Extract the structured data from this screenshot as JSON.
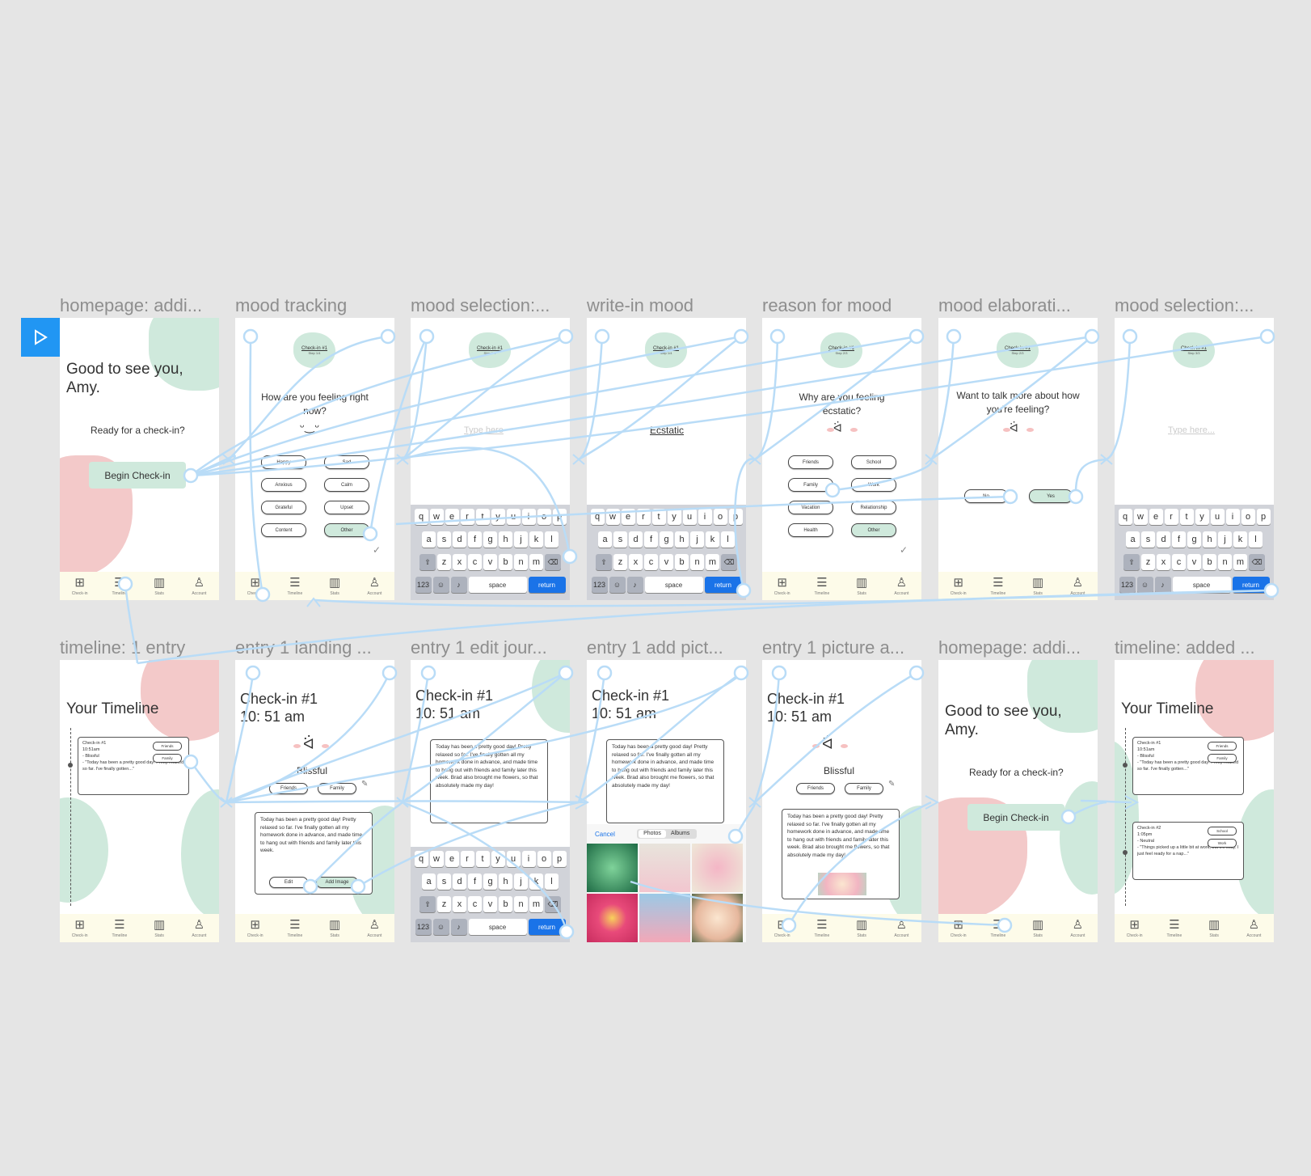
{
  "colors": {
    "canvas": "#e5e5e5",
    "accent": "#2196f3",
    "mint": "#cfe9dc",
    "pink": "#f3c9c9",
    "wire": "#b9dcf7",
    "tabbar": "#fdfbe9",
    "ios_blue": "#1a73e8"
  },
  "frame_titles": [
    "homepage: addi...",
    "mood tracking",
    "mood selection:...",
    "write-in mood",
    "reason for mood",
    "mood elaborati...",
    "mood selection:...",
    "timeline: 1 entry",
    "entry 1 landing ...",
    "entry 1 edit jour...",
    "entry 1 add pict...",
    "entry 1 picture a...",
    "homepage: addi...",
    "timeline: added ..."
  ],
  "tabbar": {
    "checkin": "Check-in",
    "timeline": "Timeline",
    "stats": "Stats",
    "account": "Account"
  },
  "home": {
    "greeting": "Good to see you, Amy.",
    "prompt": "Ready for a check-in?",
    "button": "Begin Check-in"
  },
  "badge": {
    "checkin1": "Check-in #1",
    "step14": "Step 1/4",
    "step23": "Step 2/3",
    "step33": "Step 3/3"
  },
  "mood": {
    "question": "How are you feeling right now?",
    "options": [
      "Happy",
      "Sad",
      "Anxious",
      "Calm",
      "Grateful",
      "Upset",
      "Content",
      "Other"
    ]
  },
  "writein": {
    "placeholder": "Type here",
    "value": "Ecstatic",
    "placeholder2": "Type here..."
  },
  "reason": {
    "question": "Why are you feeling ecstatic?",
    "options": [
      "Friends",
      "School",
      "Family",
      "Work",
      "Vacation",
      "Relationship",
      "Health",
      "Other"
    ]
  },
  "elaborate": {
    "question": "Want to talk more about how you're feeling?",
    "no": "No",
    "yes": "Yes"
  },
  "keyboard": {
    "row1": [
      "q",
      "w",
      "e",
      "r",
      "t",
      "y",
      "u",
      "i",
      "o",
      "p"
    ],
    "row2": [
      "a",
      "s",
      "d",
      "f",
      "g",
      "h",
      "j",
      "k",
      "l"
    ],
    "row3": [
      "z",
      "x",
      "c",
      "v",
      "b",
      "n",
      "m"
    ],
    "num": "123",
    "space": "space",
    "return": "return"
  },
  "timeline": {
    "title": "Your Timeline",
    "entry1_title": "Check-in #1",
    "entry1_time": "10:51am",
    "entry1_mood": "- Blissful",
    "entry1_quote": "- \"Today has been a pretty good day! Pretty relaxed so far. I've finally gotten...\"",
    "entry1_tags": [
      "Friends",
      "Family"
    ],
    "entry2_title": "Check-in #2",
    "entry2_time": "1:05pm",
    "entry2_mood": "- Neutral",
    "entry2_quote": "- \"Things picked up a little bit at work, but it's okay. I just feel ready for a nap...\"",
    "entry2_tags": [
      "School",
      "Work"
    ]
  },
  "entry": {
    "title": "Check-in #1",
    "time": "10: 51 am",
    "mood": "Blissful",
    "tags": [
      "Friends",
      "Family"
    ],
    "journal_short": "Today has been a pretty good day! Pretty relaxed so far. I've finally gotten all my homework done in advance, and made time to hang out with friends and family later this week.",
    "journal_long": "Today has been a pretty good day! Pretty relaxed so far. I've finally gotten all my homework done in advance, and made time to hang out with friends and family later this week. Brad also brought me flowers, so that absolutely made my day!",
    "edit": "Edit",
    "add_image": "Add Image"
  },
  "picker": {
    "cancel": "Cancel",
    "photos": "Photos",
    "albums": "Albums"
  }
}
